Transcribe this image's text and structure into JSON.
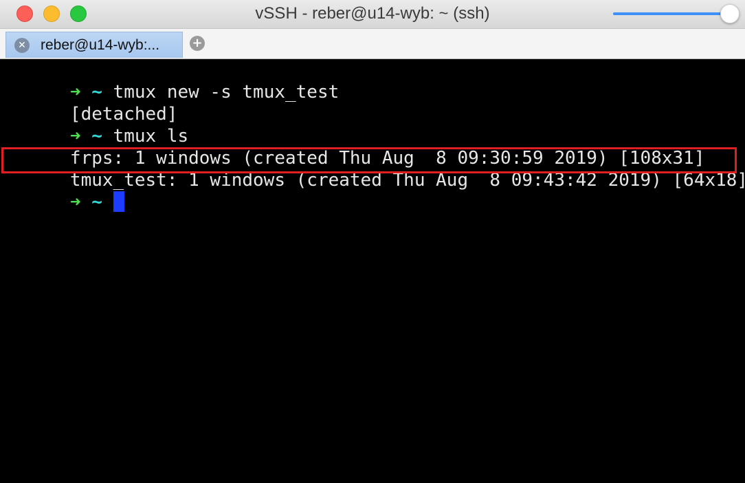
{
  "window": {
    "title": "vSSH - reber@u14-wyb: ~ (ssh)",
    "volume_level_percent": 100
  },
  "tabs": [
    {
      "label": "reber@u14-wyb:...",
      "close_symbol": "✕"
    }
  ],
  "new_tab_symbol": "+",
  "terminal": {
    "prompt_arrow": "➜",
    "prompt_dir": "~",
    "lines": [
      {
        "type": "prompt",
        "command": "tmux new -s tmux_test"
      },
      {
        "type": "output",
        "text": "[detached]"
      },
      {
        "type": "prompt",
        "command": "tmux ls"
      },
      {
        "type": "output",
        "text": "frps: 1 windows (created Thu Aug  8 09:30:59 2019) [108x31]"
      },
      {
        "type": "output",
        "text": "tmux_test: 1 windows (created Thu Aug  8 09:43:42 2019) [64x18]"
      },
      {
        "type": "prompt",
        "command": ""
      }
    ]
  },
  "colors": {
    "prompt_arrow": "#4ee04e",
    "prompt_dir": "#36d7d7",
    "cursor": "#1c3cff",
    "highlight_box": "#e02020"
  },
  "icons": [
    "close-icon",
    "minimize-icon",
    "zoom-icon",
    "tab-close-icon",
    "add-tab-icon",
    "volume-slider"
  ]
}
